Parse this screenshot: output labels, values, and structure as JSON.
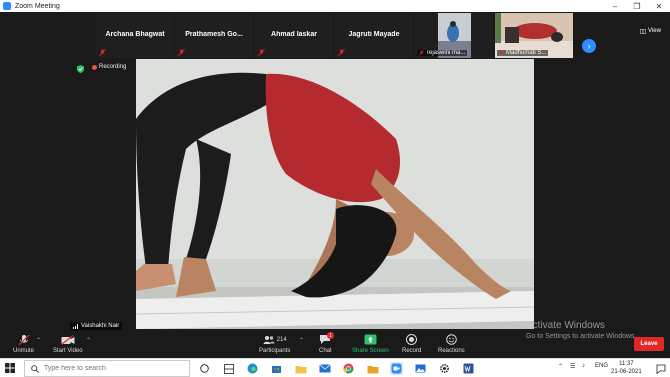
{
  "window": {
    "title": "Zoom Meeting"
  },
  "gallery": {
    "tiles": [
      {
        "name": "Archana Bhagwat"
      },
      {
        "name": "Prathamesh  Go..."
      },
      {
        "name": "Ahmad laskar"
      },
      {
        "name": "Jagruti Mayade"
      }
    ],
    "video_tiles": [
      {
        "name": "Tejaswini ma..."
      },
      {
        "name": "Madhumati S..."
      }
    ],
    "view_label": "View"
  },
  "status": {
    "recording_label": "Recording"
  },
  "active_speaker": {
    "name": "Vaishakhi Nair"
  },
  "toolbar": {
    "unmute": "Unmute",
    "start_video": "Start Video",
    "participants_count": "214",
    "participants": "Participants",
    "chat": "Chat",
    "chat_badge": "1",
    "share_screen": "Share Screen",
    "record": "Record",
    "reactions": "Reactions",
    "leave": "Leave"
  },
  "watermark": {
    "line1": "Activate Windows",
    "line2": "Go to Settings to activate Windows."
  },
  "taskbar": {
    "search_placeholder": "Type here to search",
    "language": "ENG",
    "time": "11:37",
    "date": "21-06-2021"
  },
  "colors": {
    "accent": "#2d8cff",
    "leave": "#e02828",
    "share": "#2fc26a",
    "recording": "#e8543c"
  }
}
